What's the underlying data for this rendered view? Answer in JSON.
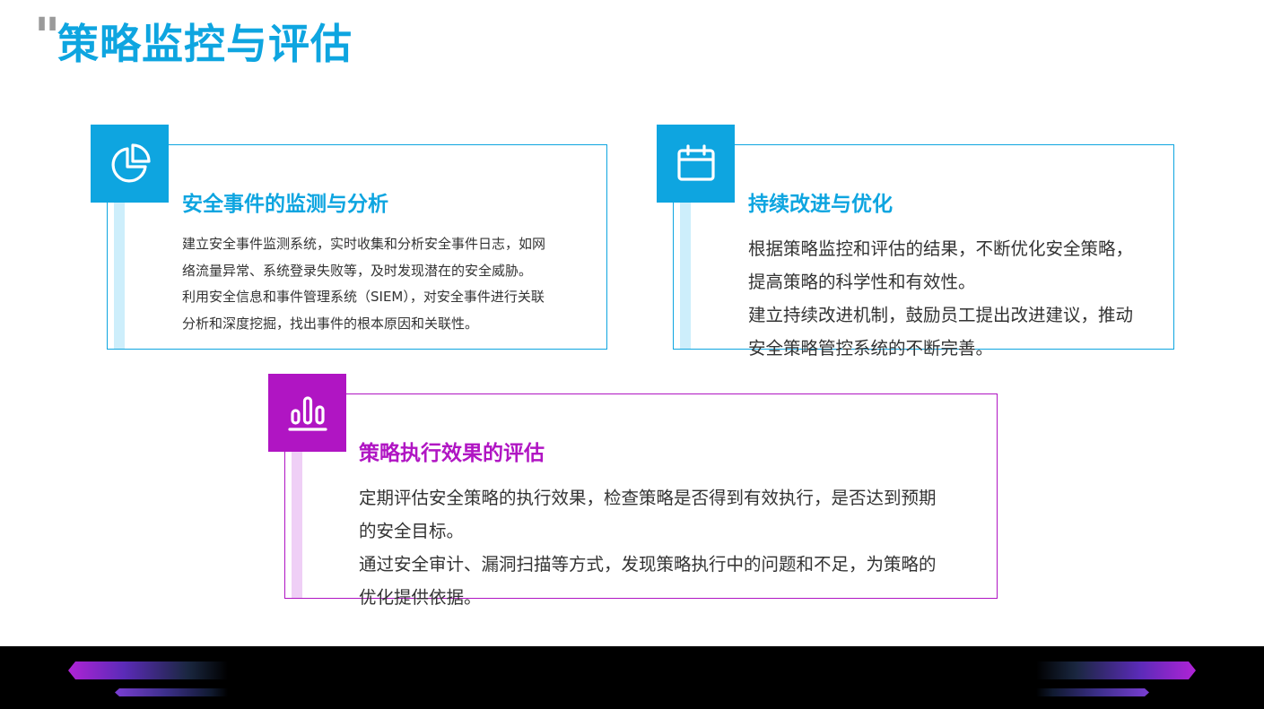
{
  "title": {
    "quote_mark": "\"",
    "text": "策略监控与评估"
  },
  "cards": {
    "monitoring": {
      "icon": "pie-chart-icon",
      "heading": "安全事件的监测与分析",
      "lines": [
        "建立安全事件监测系统，实时收集和分析安全事件日志，如网",
        "络流量异常、系统登录失败等，及时发现潜在的安全威胁。",
        "利用安全信息和事件管理系统（SIEM），对安全事件进行关联",
        "分析和深度挖掘，找出事件的根本原因和关联性。"
      ]
    },
    "improvement": {
      "icon": "calendar-icon",
      "heading": "持续改进与优化",
      "lines": [
        "根据策略监控和评估的结果，不断优化安全策略，",
        "提高策略的科学性和有效性。",
        "建立持续改进机制，鼓励员工提出改进建议，推动",
        "安全策略管控系统的不断完善。"
      ]
    },
    "evaluation": {
      "icon": "bar-chart-icon",
      "heading": "策略执行效果的评估",
      "lines": [
        "定期评估安全策略的执行效果，检查策略是否得到有效执行，是否达到预期",
        "的安全目标。",
        "通过安全审计、漏洞扫描等方式，发现策略执行中的问题和不足，为策略的",
        "优化提供依据。"
      ]
    }
  },
  "colors": {
    "blue_accent": "#0ea5e0",
    "purple_accent": "#b015c3",
    "blue_stripe": "#cdeefb",
    "purple_stripe": "#efcff6",
    "body_text": "#333333",
    "footer_bg": "#000000"
  }
}
